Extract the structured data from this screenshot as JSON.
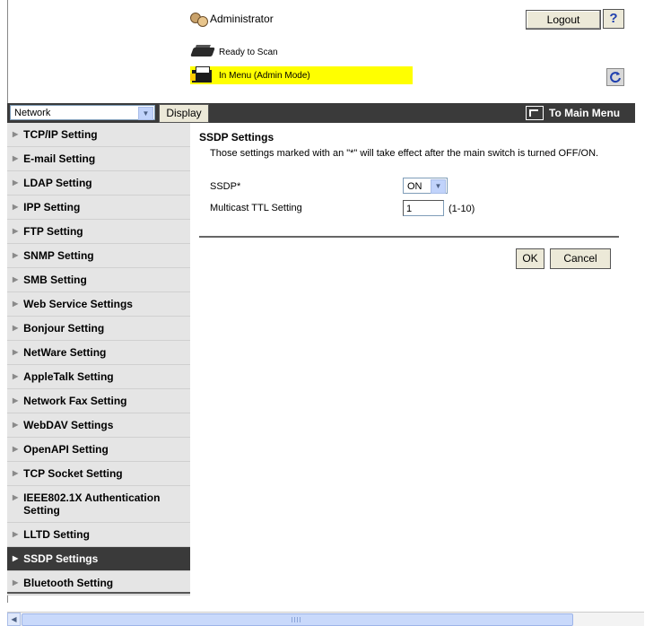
{
  "header": {
    "user_label": "Administrator",
    "logout_label": "Logout",
    "help_label": "?",
    "status_ready": "Ready to Scan",
    "status_mode": "In Menu (Admin Mode)"
  },
  "toolbar": {
    "category_selected": "Network",
    "display_label": "Display",
    "main_menu_label": "To Main Menu"
  },
  "sidebar": {
    "items": [
      {
        "label": "TCP/IP Setting"
      },
      {
        "label": "E-mail Setting"
      },
      {
        "label": "LDAP Setting"
      },
      {
        "label": "IPP Setting"
      },
      {
        "label": "FTP Setting"
      },
      {
        "label": "SNMP Setting"
      },
      {
        "label": "SMB Setting"
      },
      {
        "label": "Web Service Settings"
      },
      {
        "label": "Bonjour Setting"
      },
      {
        "label": "NetWare Setting"
      },
      {
        "label": "AppleTalk Setting"
      },
      {
        "label": "Network Fax Setting"
      },
      {
        "label": "WebDAV Settings"
      },
      {
        "label": "OpenAPI Setting"
      },
      {
        "label": "TCP Socket Setting"
      },
      {
        "label": "IEEE802.1X Authentication Setting"
      },
      {
        "label": "LLTD Setting"
      },
      {
        "label": "SSDP Settings",
        "active": true
      },
      {
        "label": "Bluetooth Setting"
      }
    ]
  },
  "main": {
    "title": "SSDP Settings",
    "note": "Those settings marked with an \"*\" will take effect after the main switch is turned OFF/ON.",
    "ssdp_label": "SSDP*",
    "ssdp_value": "ON",
    "ttl_label": "Multicast TTL Setting",
    "ttl_value": "1",
    "ttl_range": "(1-10)",
    "ok_label": "OK",
    "cancel_label": "Cancel"
  },
  "colors": {
    "status_highlight": "#ffff00",
    "bar_dark": "#3a3a3a",
    "sidebar_bg": "#e5e5e5"
  }
}
